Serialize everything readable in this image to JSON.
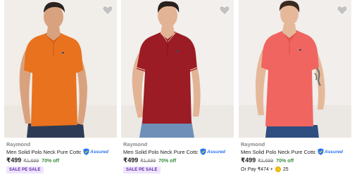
{
  "products": [
    {
      "brand": "Raymond",
      "title": "Men Solid Polo Neck Pure Cotton T-Shirt",
      "assured_label": "Assured",
      "price": "₹499",
      "mrp": "₹1,699",
      "discount": "70% off",
      "badge": "SALE PE SALE",
      "shirt_color": "#e8721e"
    },
    {
      "brand": "Raymond",
      "title": "Men Solid Polo Neck Pure Cotton T-Shirt",
      "assured_label": "Assured",
      "price": "₹499",
      "mrp": "₹1,699",
      "discount": "70% off",
      "badge": "SALE PE SALE",
      "shirt_color": "#9b1c24"
    },
    {
      "brand": "Raymond",
      "title": "Men Solid Polo Neck Pure Cotton T-Shirt",
      "assured_label": "Assured",
      "price": "₹499",
      "mrp": "₹1,699",
      "discount": "70% off",
      "pay_prefix": "Or Pay ₹474 +",
      "coins": "25",
      "shirt_color": "#f06560"
    }
  ],
  "icons": {
    "wishlist": "heart-icon",
    "assured": "shield-check-icon",
    "coin": "supercoin-icon"
  },
  "colors": {
    "accent": "#2874f0",
    "discount_green": "#388e3c",
    "badge_bg": "#efe3ff",
    "badge_text": "#5d2ca5"
  }
}
